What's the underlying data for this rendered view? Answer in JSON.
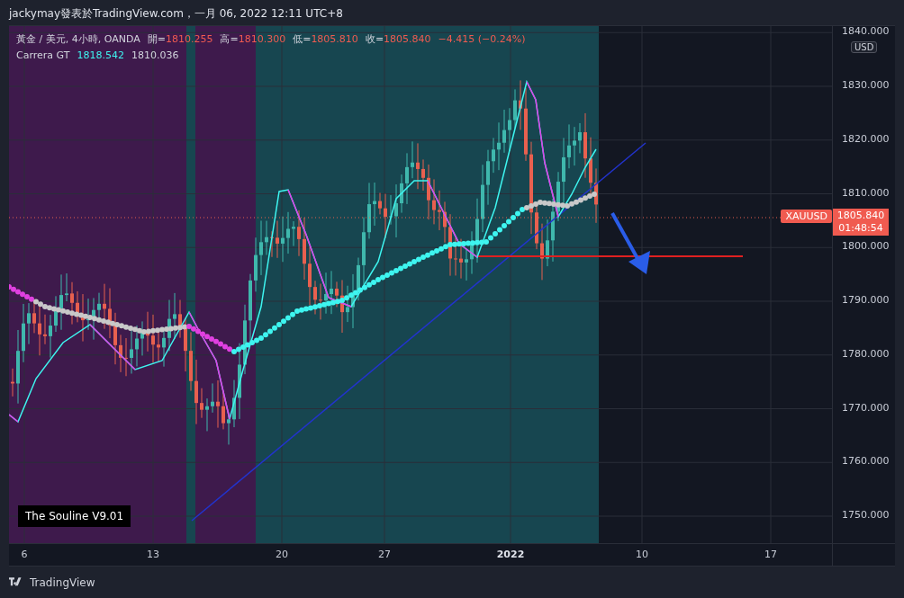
{
  "header": {
    "title": "jackymay發表於TradingView.com，一月 06, 2022 12:11 UTC+8"
  },
  "legend": {
    "symbol": "黃金 / 美元, 4小時, OANDA",
    "ohlc": [
      {
        "label": "開=",
        "value": "1810.255"
      },
      {
        "label": "高=",
        "value": "1810.300"
      },
      {
        "label": "低=",
        "value": "1805.810"
      },
      {
        "label": "收=",
        "value": "1805.840"
      }
    ],
    "change": "−4.415 (−0.24%)",
    "indicator": {
      "name": "Carrera GT",
      "value_1": "1818.542",
      "value_2": "1810.036"
    }
  },
  "price_axis": {
    "currency": "USD",
    "labels": [
      "1840.000",
      "1830.000",
      "1820.000",
      "1810.000",
      "1800.000",
      "1790.000",
      "1780.000",
      "1770.000",
      "1760.000",
      "1750.000"
    ],
    "last_price": "1805.840",
    "countdown": "01:48:54",
    "symbol_tag": "XAUUSD"
  },
  "time_axis": {
    "labels": [
      {
        "text": "6",
        "kind": "day"
      },
      {
        "text": "13",
        "kind": "day"
      },
      {
        "text": "20",
        "kind": "day"
      },
      {
        "text": "27",
        "kind": "day"
      },
      {
        "text": "2022",
        "kind": "year"
      },
      {
        "text": "10",
        "kind": "day"
      },
      {
        "text": "17",
        "kind": "day"
      }
    ]
  },
  "chart_caption": "The Souline V9.01",
  "footer": {
    "brand": "TradingView"
  }
}
